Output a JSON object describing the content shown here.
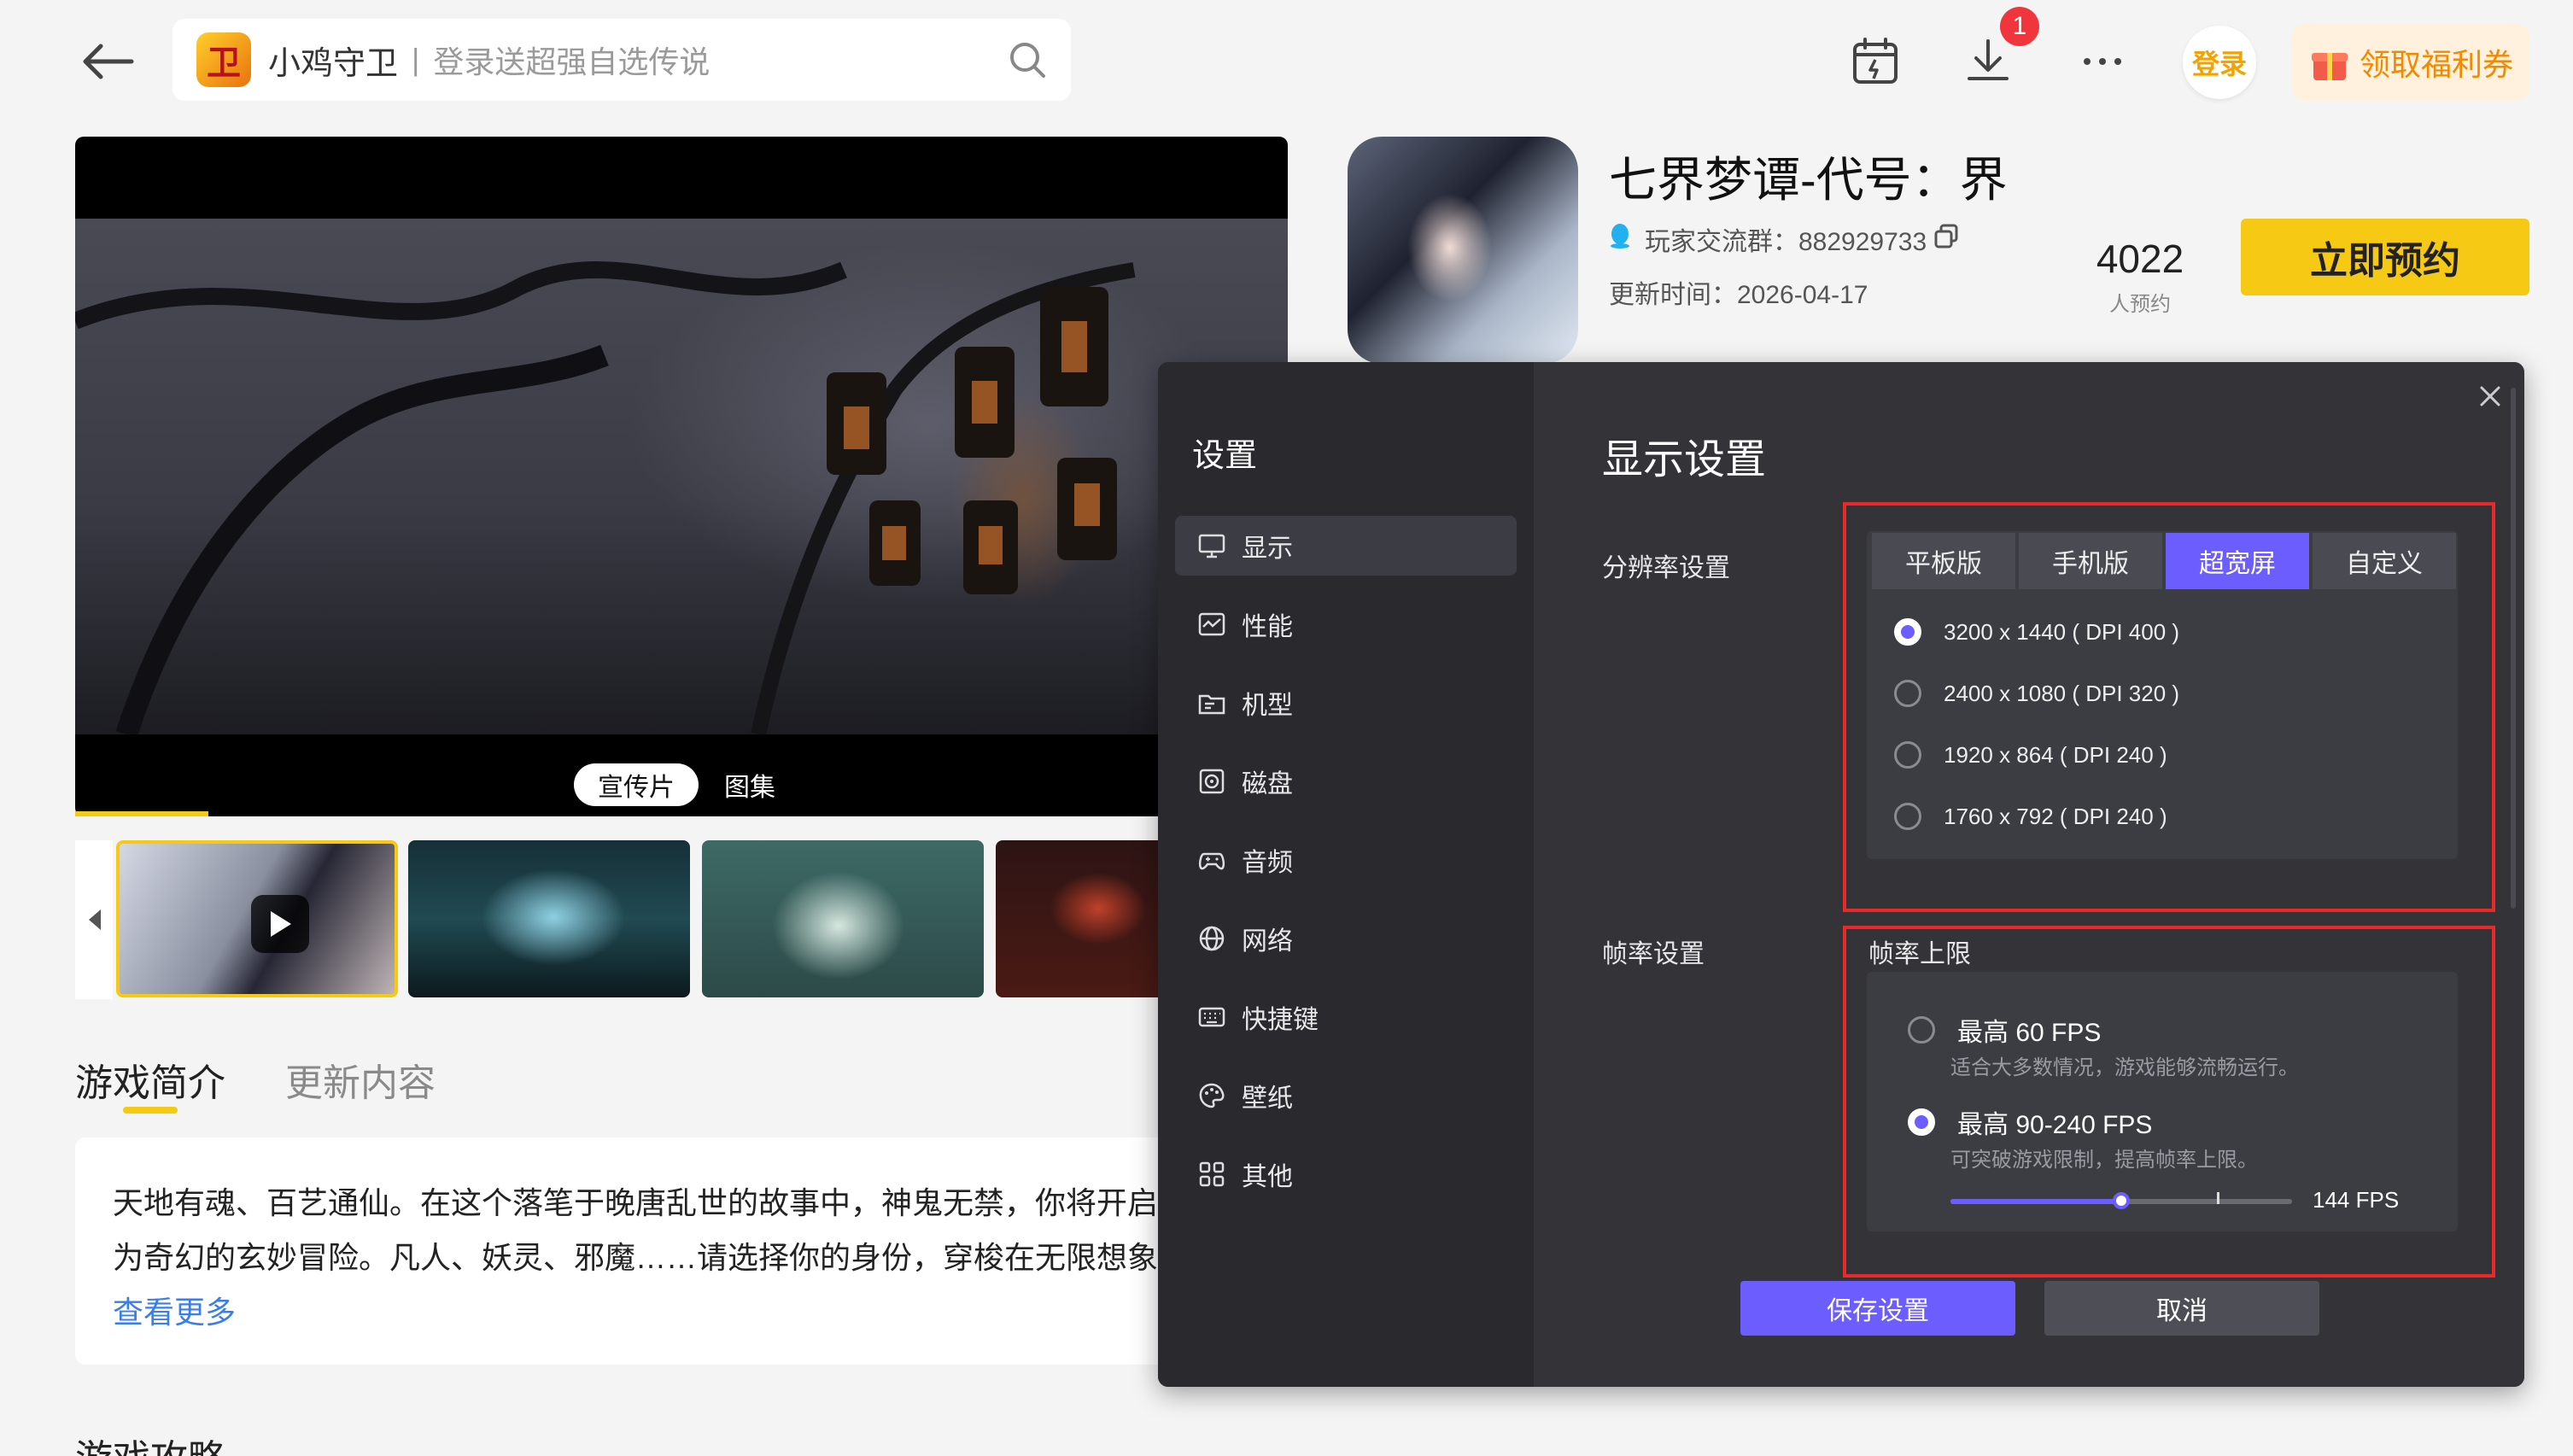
{
  "search": {
    "game_name": "小鸡守卫",
    "separator": "|",
    "hint": "登录送超强自选传说"
  },
  "topbar": {
    "download_badge": "1",
    "login_label": "登录",
    "welfare_label": "领取福利券"
  },
  "media": {
    "tab_promo": "宣传片",
    "tab_gallery": "图集"
  },
  "game": {
    "title": "七界梦谭-代号：界",
    "group_label": "玩家交流群：882929733",
    "update_label": "更新时间：2026-04-17",
    "reserve_count": "4022",
    "reserve_unit": "人预约",
    "reserve_button": "立即预约"
  },
  "intro": {
    "tab_intro": "游戏简介",
    "tab_update": "更新内容",
    "line1": "天地有魂、百艺通仙。在这个落笔于晚唐乱世的故事中，神鬼无禁，你将开启一",
    "line2": "为奇幻的玄妙冒险。凡人、妖灵、邪魔……请选择你的身份，穿梭在无限想象的",
    "more": "查看更多",
    "guide_title": "游戏攻略"
  },
  "settings": {
    "sidebar_title": "设置",
    "nav": [
      {
        "label": "显示",
        "icon": "monitor-icon",
        "active": true
      },
      {
        "label": "性能",
        "icon": "performance-icon"
      },
      {
        "label": "机型",
        "icon": "folder-icon"
      },
      {
        "label": "磁盘",
        "icon": "disk-icon"
      },
      {
        "label": "音频",
        "icon": "gamepad-icon"
      },
      {
        "label": "网络",
        "icon": "globe-icon"
      },
      {
        "label": "快捷键",
        "icon": "keyboard-icon"
      },
      {
        "label": "壁纸",
        "icon": "palette-icon"
      },
      {
        "label": "其他",
        "icon": "grid-icon"
      }
    ],
    "title": "显示设置",
    "resolution_label": "分辨率设置",
    "resolution_tabs": [
      "平板版",
      "手机版",
      "超宽屏",
      "自定义"
    ],
    "resolution_active_tab": 2,
    "resolutions": [
      {
        "label": "3200 x 1440 ( DPI 400 )",
        "selected": true
      },
      {
        "label": "2400 x 1080 ( DPI 320 )",
        "selected": false
      },
      {
        "label": "1920 x 864 ( DPI 240 )",
        "selected": false
      },
      {
        "label": "1760 x 792 ( DPI 240 )",
        "selected": false
      }
    ],
    "fps_label": "帧率设置",
    "fps_limit_title": "帧率上限",
    "fps_options": [
      {
        "label": "最高 60 FPS",
        "desc": "适合大多数情况，游戏能够流畅运行。",
        "selected": false
      },
      {
        "label": "最高 90-240 FPS",
        "desc": "可突破游戏限制，提高帧率上限。",
        "selected": true
      }
    ],
    "fps_value": "144 FPS",
    "fps_slider_fraction": 0.5,
    "save_label": "保存设置",
    "cancel_label": "取消"
  },
  "colors": {
    "accent": "#6c5dff",
    "brand_yellow": "#f6c915",
    "highlight_red": "#e82a2a"
  }
}
